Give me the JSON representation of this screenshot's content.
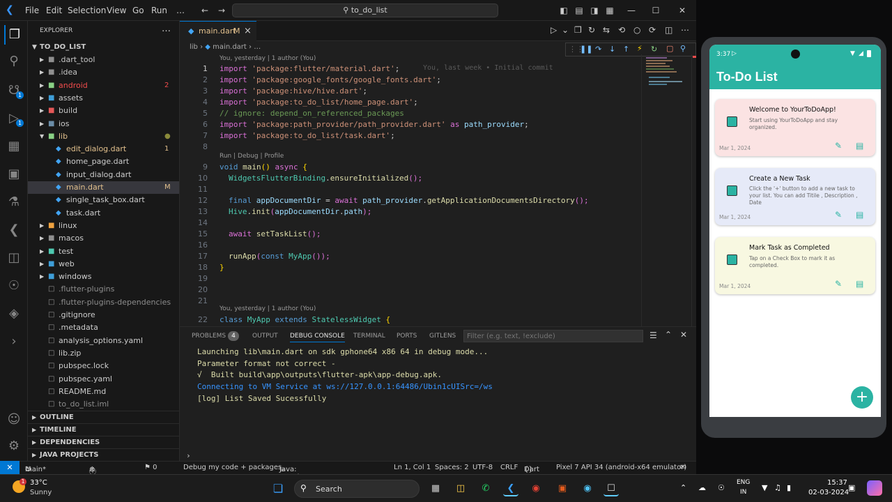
{
  "window": {
    "menus": [
      "File",
      "Edit",
      "Selection",
      "View",
      "Go",
      "Run"
    ],
    "more": "…",
    "search": "to_do_list"
  },
  "activity": {
    "scm_badge": "1",
    "debug_badge": "1"
  },
  "explorer": {
    "title": "EXPLORER",
    "more": "…",
    "root": "TO_DO_LIST",
    "items": [
      {
        "label": ".dart_tool",
        "color": "#c5c5c5",
        "badge": ""
      },
      {
        "label": ".idea",
        "color": "#c5c5c5",
        "badge": ""
      },
      {
        "label": "android",
        "color": "#f14c4c",
        "badge": "2"
      },
      {
        "label": "assets",
        "color": "#cccccc",
        "badge": ""
      },
      {
        "label": "build",
        "color": "#c5c5c5",
        "badge": ""
      },
      {
        "label": "ios",
        "color": "#cccccc",
        "badge": ""
      },
      {
        "label": "lib",
        "color": "#e2c08d",
        "badge": "●"
      },
      {
        "label": "edit_dialog.dart",
        "color": "#e2c08d",
        "badge": "1"
      },
      {
        "label": "home_page.dart",
        "color": "#cccccc",
        "badge": ""
      },
      {
        "label": "input_dialog.dart",
        "color": "#cccccc",
        "badge": ""
      },
      {
        "label": "main.dart",
        "color": "#e2c08d",
        "badge": "M"
      },
      {
        "label": "single_task_box.dart",
        "color": "#cccccc",
        "badge": ""
      },
      {
        "label": "task.dart",
        "color": "#cccccc",
        "badge": ""
      },
      {
        "label": "linux",
        "color": "#cccccc",
        "badge": ""
      },
      {
        "label": "macos",
        "color": "#cccccc",
        "badge": ""
      },
      {
        "label": "test",
        "color": "#cccccc",
        "badge": ""
      },
      {
        "label": "web",
        "color": "#cccccc",
        "badge": ""
      },
      {
        "label": "windows",
        "color": "#cccccc",
        "badge": ""
      },
      {
        "label": ".flutter-plugins",
        "color": "#8c8c8c",
        "badge": ""
      },
      {
        "label": ".flutter-plugins-dependencies",
        "color": "#8c8c8c",
        "badge": ""
      },
      {
        "label": ".gitignore",
        "color": "#cccccc",
        "badge": ""
      },
      {
        "label": ".metadata",
        "color": "#cccccc",
        "badge": ""
      },
      {
        "label": "analysis_options.yaml",
        "color": "#cccccc",
        "badge": ""
      },
      {
        "label": "lib.zip",
        "color": "#cccccc",
        "badge": ""
      },
      {
        "label": "pubspec.lock",
        "color": "#cccccc",
        "badge": ""
      },
      {
        "label": "pubspec.yaml",
        "color": "#cccccc",
        "badge": ""
      },
      {
        "label": "README.md",
        "color": "#cccccc",
        "badge": ""
      },
      {
        "label": "to_do_list.iml",
        "color": "#8c8c8c",
        "badge": ""
      }
    ],
    "sections": [
      "OUTLINE",
      "TIMELINE",
      "DEPENDENCIES",
      "JAVA PROJECTS"
    ]
  },
  "editor": {
    "tab": {
      "label": "main.dart",
      "modified": "M",
      "close": "×"
    },
    "breadcrumb": {
      "folder": "lib",
      "sep": "›",
      "file": "main.dart",
      "rest": "› …"
    },
    "blame_top": "You, yesterday | 1 author (You)",
    "inline_blame": "You, last week • Initial commit",
    "run_lens": "Run | Debug | Profile",
    "blame_bottom": "You, yesterday | 1 author (You)",
    "line_numbers": [
      "1",
      "2",
      "3",
      "4",
      "5",
      "6",
      "7",
      "8",
      "9",
      "10",
      "11",
      "12",
      "13",
      "14",
      "15",
      "16",
      "17",
      "18",
      "19",
      "20",
      "21",
      "22"
    ],
    "code": {
      "l1a": "import",
      "l1b": "'package:flutter/material.dart'",
      "l1c": ";",
      "l2a": "import",
      "l2b": "'package:google_fonts/google_fonts.dart'",
      "l2c": ";",
      "l3a": "import",
      "l3b": "'package:hive/hive.dart'",
      "l3c": ";",
      "l4a": "import",
      "l4b": "'package:to_do_list/home_page.dart'",
      "l4c": ";",
      "l5": "// ignore: depend_on_referenced_packages",
      "l6a": "import",
      "l6b": "'package:path_provider/path_provider.dart'",
      "l6c": "as",
      "l6d": "path_provider",
      "l6e": ";",
      "l7a": "import",
      "l7b": "'package:to_do_list/task.dart'",
      "l7c": ";",
      "l9a": "void",
      "l9b": "main",
      "l9c": "()",
      "l9d": "async",
      "l9e": "{",
      "l10a": "WidgetsFlutterBinding",
      "l10b": ".",
      "l10c": "ensureInitialized",
      "l10d": "();",
      "l12a": "final",
      "l12b": "appDocumentDir",
      "l12c": " = ",
      "l12d": "await",
      "l12e": "path_provider",
      "l12f": ".",
      "l12g": "getApplicationDocumentsDirectory",
      "l12h": "();",
      "l13a": "Hive",
      "l13b": ".",
      "l13c": "init",
      "l13d": "(",
      "l13e": "appDocumentDir",
      "l13f": ".",
      "l13g": "path",
      "l13h": ");",
      "l15a": "await",
      "l15b": "setTaskList",
      "l15c": "();",
      "l17a": "runApp",
      "l17b": "(",
      "l17c": "const",
      "l17d": "MyApp",
      "l17e": "());",
      "l18": "}",
      "l22a": "class",
      "l22b": "MyApp",
      "l22c": "extends",
      "l22d": "StatelessWidget",
      "l22e": "{"
    }
  },
  "panel": {
    "tabs": [
      "PROBLEMS",
      "OUTPUT",
      "DEBUG CONSOLE",
      "TERMINAL",
      "PORTS",
      "GITLENS"
    ],
    "problems_count": "4",
    "filter_placeholder": "Filter (e.g. text, !exclude)",
    "console": [
      {
        "text": "Launching lib\\main.dart on sdk gphone64 x86 64 in debug mode...",
        "color": "#dcdcaa"
      },
      {
        "text": "Parameter format not correct -",
        "color": "#dcdcaa"
      },
      {
        "text": "√  Built build\\app\\outputs\\flutter-apk\\app-debug.apk.",
        "color": "#dcdcaa"
      },
      {
        "text": "Connecting to VM Service at ws://127.0.0.1:64486/Ubin1cUISrc=/ws",
        "color": "#3794ff"
      },
      {
        "text": "[log] List Saved Sucessfully",
        "color": "#dcdcaa"
      }
    ],
    "prompt": "›"
  },
  "status": {
    "branch": "main*",
    "errors": "⊗ 2",
    "warnings": "⚠ 1",
    "infos": "ⓘ 1",
    "ports": "⚑ 0",
    "debug": "Debug my code + packages",
    "java": "Java: Warning",
    "position": "Ln 1, Col 1",
    "spaces": "Spaces: 2",
    "encoding": "UTF-8",
    "eol": "CRLF",
    "language": "Dart",
    "device": "Pixel 7 API 34 (android-x64 emulator)"
  },
  "phone": {
    "time": "3:37",
    "app_title": "To-Do List",
    "tasks": [
      {
        "title": "Welcome to YourToDoApp!",
        "desc": "Start using YourToDoApp and stay organized.",
        "date": "Mar 1, 2024",
        "bg": "#fbe3e3"
      },
      {
        "title": "Create a New Task",
        "desc": "Click the '+' button to add a new task to your list. You can add Titile , Description , Date",
        "date": "Mar 1, 2024",
        "bg": "#e6eaf8"
      },
      {
        "title": "Mark Task as Completed",
        "desc": "Tap on a Check Box to mark it as completed.",
        "date": "Mar 1, 2024",
        "bg": "#f8f8e1"
      }
    ],
    "fab": "+"
  },
  "taskbar": {
    "temp": "33°C",
    "weather": "Sunny",
    "weather_badge": "1",
    "search": "Search",
    "lang1": "ENG",
    "lang2": "IN",
    "time": "15:37",
    "date": "02-03-2024"
  }
}
